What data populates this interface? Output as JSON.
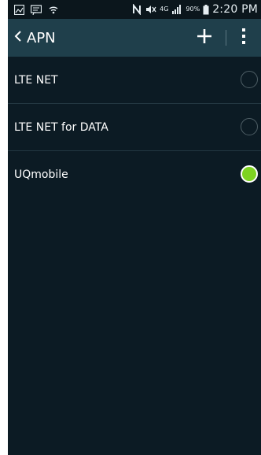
{
  "status_bar": {
    "battery_pct": "90%",
    "time": "2:20 PM",
    "network": "4G"
  },
  "app_bar": {
    "title": "APN"
  },
  "apn_list": [
    {
      "label": "LTE NET",
      "selected": false
    },
    {
      "label": "LTE NET for DATA",
      "selected": false
    },
    {
      "label": "UQmobile",
      "selected": true
    }
  ],
  "colors": {
    "background": "#0c1b24",
    "app_bar": "#1f3f4b",
    "selected_radio": "#7ed321"
  }
}
